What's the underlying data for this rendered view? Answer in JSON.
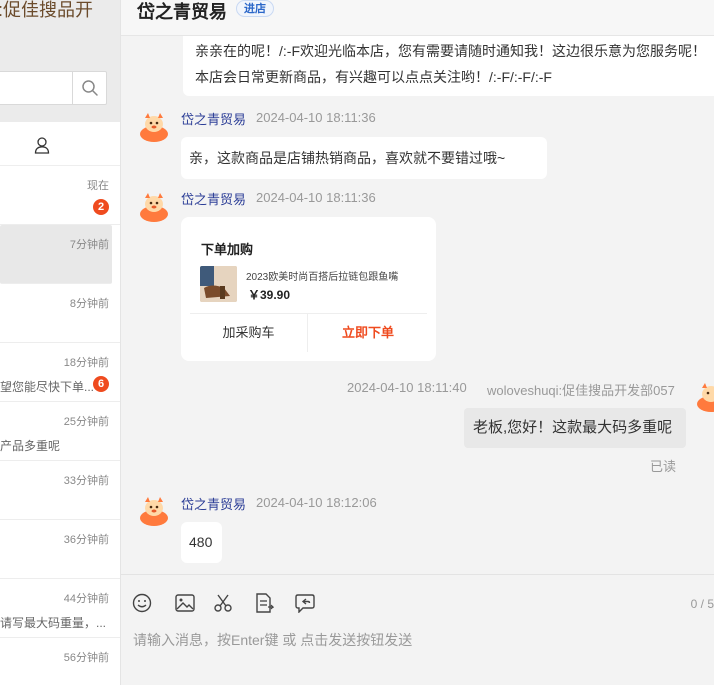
{
  "left_panel": {
    "title": ":促佳搜品开",
    "search": {
      "placeholder": ""
    },
    "conversations": [
      {
        "time": "现在",
        "preview": "",
        "badge": "2"
      },
      {
        "time": "7分钟前",
        "preview": "",
        "badge": ""
      },
      {
        "time": "8分钟前",
        "preview": "",
        "badge": ""
      },
      {
        "time": "18分钟前",
        "preview": "望您能尽快下单...",
        "badge": "6"
      },
      {
        "time": "25分钟前",
        "preview": "产品多重呢",
        "badge": ""
      },
      {
        "time": "33分钟前",
        "preview": "",
        "badge": ""
      },
      {
        "time": "36分钟前",
        "preview": "",
        "badge": ""
      },
      {
        "time": "44分钟前",
        "preview": "请写最大码重量，...",
        "badge": ""
      },
      {
        "time": "56分钟前",
        "preview": "",
        "badge": ""
      }
    ]
  },
  "chat": {
    "shop_name": "岱之青贸易",
    "shop_tag": "进店",
    "welcome_text": "亲亲在的呢！/:-F欢迎光临本店，您有需要请随时通知我！这边很乐意为您服务呢！本店会日常更新商品，有兴趣可以点点关注哟！/:-F/:-F/:-F",
    "msg1": {
      "sender": "岱之青贸易",
      "time": "2024-04-10 18:11:36",
      "text": "亲，这款商品是店铺热销商品，喜欢就不要错过哦~"
    },
    "msg2": {
      "sender": "岱之青贸易",
      "time": "2024-04-10 18:11:36"
    },
    "card": {
      "title": "下单加购",
      "product_name": "2023欧美时尚百搭后拉链包跟鱼嘴",
      "price": "￥39.90",
      "btn_cart": "加采购车",
      "btn_order": "立即下单"
    },
    "my_msg": {
      "time": "2024-04-10 18:11:40",
      "sender": "woloveshuqi:促佳搜品开发部057",
      "text": "老板,您好！这款最大码多重呢",
      "status": "已读"
    },
    "msg4": {
      "sender": "岱之青贸易",
      "time": "2024-04-10 18:12:06",
      "text": "480"
    }
  },
  "input": {
    "placeholder": "请输入消息，按Enter键 或 点击发送按钮发送",
    "count": "0 / 5"
  },
  "colors": {
    "accent": "#ef4b1f",
    "sender": "#2c3e97",
    "link": "#2b67c9"
  },
  "icons": [
    "search-icon",
    "contact-icon",
    "emoji-icon",
    "image-icon",
    "scissors-icon",
    "document-icon",
    "history-icon",
    "shop-avatar-icon"
  ]
}
